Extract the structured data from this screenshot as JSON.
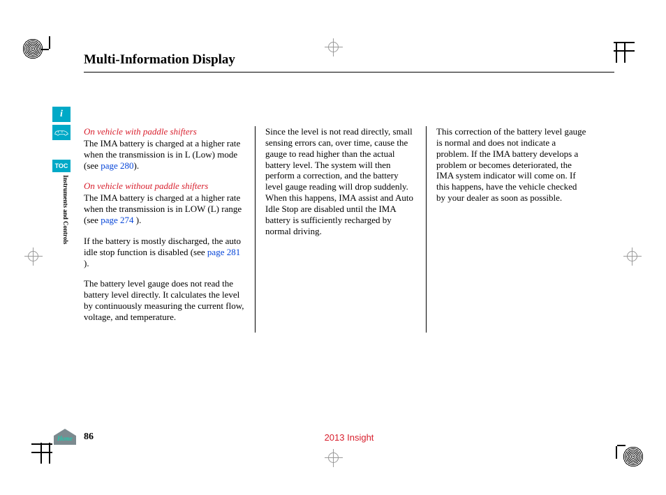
{
  "title": "Multi-Information Display",
  "section_label": "Instruments and Controls",
  "sidebar": {
    "info_icon": "i",
    "toc_label": "TOC"
  },
  "column1": {
    "note1": "On vehicle with paddle shifters",
    "p1a": "The IMA battery is charged at a higher rate when the transmission is in L (Low) mode (see ",
    "link1": "page 280",
    "p1b": ").",
    "note2": "On vehicle without paddle shifters",
    "p2a": "The IMA battery is charged at a higher rate when the transmission is in LOW (L) range (see ",
    "link2": "page 274",
    "p2b": " ).",
    "p3a": "If the battery is mostly discharged, the auto idle stop function is disabled (see ",
    "link3": "page 281",
    "p3b": " ).",
    "p4": "The battery level gauge does not read the battery level directly. It calculates the level by continuously measuring the current flow, voltage, and temperature."
  },
  "column2": {
    "p1": "Since the level is not read directly, small sensing errors can, over time, cause the gauge to read higher than the actual battery level. The system will then perform a correction, and the battery level gauge reading will drop suddenly. When this happens, IMA assist and Auto Idle Stop are disabled until the IMA battery is sufficiently recharged by normal driving."
  },
  "column3": {
    "p1": "This correction of the battery level gauge is normal and does not indicate a problem. If the IMA battery develops a problem or becomes deteriorated, the IMA system indicator will come on. If this happens, have the vehicle checked by your dealer as soon as possible."
  },
  "footer": {
    "home_label": "Home",
    "page_number": "86",
    "model": "2013 Insight"
  }
}
